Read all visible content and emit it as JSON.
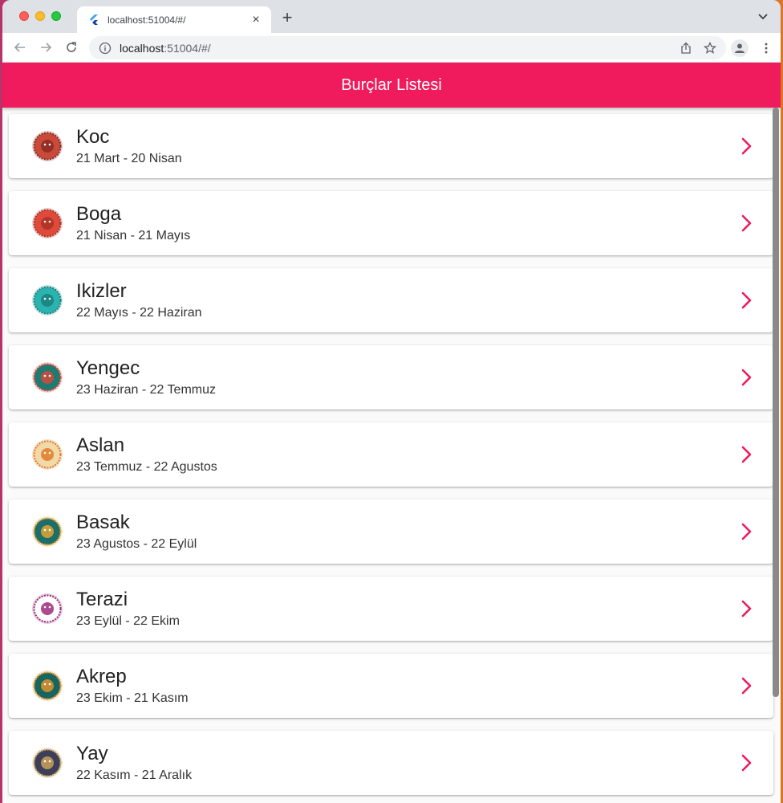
{
  "browser": {
    "tab_title": "localhost:51004/#/",
    "close_glyph": "×",
    "newtab_glyph": "+",
    "url_host": "localhost",
    "url_rest": ":51004/#/"
  },
  "app": {
    "title": "Burçlar Listesi",
    "accent_color": "#ef1b5c",
    "items": [
      {
        "name": "Koc",
        "dates": "21 Mart - 20 Nisan",
        "icon": "aries-icon",
        "colors": [
          "#c9493b",
          "#8b2a22"
        ]
      },
      {
        "name": "Boga",
        "dates": "21 Nisan - 21 Mayıs",
        "icon": "taurus-icon",
        "colors": [
          "#e04a3a",
          "#a83226"
        ]
      },
      {
        "name": "Ikizler",
        "dates": "22 Mayıs - 22 Haziran",
        "icon": "gemini-icon",
        "colors": [
          "#2bb3b0",
          "#1a7f7d"
        ]
      },
      {
        "name": "Yengec",
        "dates": "23 Haziran - 22 Temmuz",
        "icon": "cancer-icon",
        "colors": [
          "#1f7a72",
          "#d24a3a"
        ]
      },
      {
        "name": "Aslan",
        "dates": "23 Temmuz - 22 Agustos",
        "icon": "leo-icon",
        "colors": [
          "#f2d9a8",
          "#e07b2a"
        ]
      },
      {
        "name": "Basak",
        "dates": "23 Agustos - 22 Eylül",
        "icon": "virgo-icon",
        "colors": [
          "#1d6e6a",
          "#e2a531"
        ]
      },
      {
        "name": "Terazi",
        "dates": "23 Eylül - 22 Ekim",
        "icon": "libra-icon",
        "colors": [
          "#ffffff",
          "#9c2a7a"
        ]
      },
      {
        "name": "Akrep",
        "dates": "23 Ekim - 21 Kasım",
        "icon": "scorpio-icon",
        "colors": [
          "#17655f",
          "#e0902a"
        ]
      },
      {
        "name": "Yay",
        "dates": "22 Kasım - 21 Aralık",
        "icon": "sagittarius-icon",
        "colors": [
          "#3d3f5a",
          "#c9a15a"
        ]
      }
    ]
  }
}
